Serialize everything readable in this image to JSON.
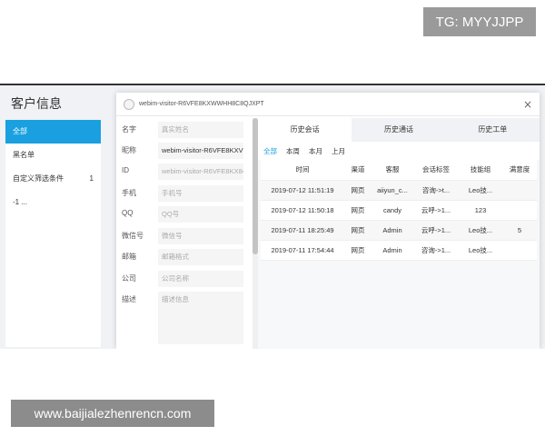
{
  "badge": "TG: MYYJJPP",
  "page_title": "客户信息",
  "sidebar": {
    "items": [
      {
        "label": "全部",
        "count": ""
      },
      {
        "label": "黑名单",
        "count": ""
      },
      {
        "label": "自定义筛选条件",
        "count": "1"
      },
      {
        "label": "-1 ...",
        "count": ""
      }
    ]
  },
  "modal": {
    "title": "webim-visitor-R6VFE8KXWWHH8C8QJXPT",
    "close": "×",
    "fields": [
      {
        "label": "名字",
        "value": "真实姓名",
        "filled": false
      },
      {
        "label": "昵称",
        "value": "webim-visitor-R6VFE8KXV",
        "filled": true
      },
      {
        "label": "ID",
        "value": "webim-visitor-R6VFE8KX8♦",
        "filled": false
      },
      {
        "label": "手机",
        "value": "手机号",
        "filled": false
      },
      {
        "label": "QQ",
        "value": "QQ号",
        "filled": false
      },
      {
        "label": "微信号",
        "value": "微信号",
        "filled": false
      },
      {
        "label": "邮箱",
        "value": "邮箱格式",
        "filled": false
      },
      {
        "label": "公司",
        "value": "公司名称",
        "filled": false
      },
      {
        "label": "描述",
        "value": "描述信息",
        "filled": false
      }
    ]
  },
  "tabs": [
    "历史会话",
    "历史通话",
    "历史工单"
  ],
  "filters": [
    "全部",
    "本周",
    "本月",
    "上月"
  ],
  "table": {
    "headers": [
      "时间",
      "渠道",
      "客服",
      "会话标签",
      "技能组",
      "满意度"
    ],
    "rows": [
      [
        "2019-07-12 11:51:19",
        "网页",
        "aiiyun_c...",
        "咨询->t...",
        "Leo技...",
        ""
      ],
      [
        "2019-07-12 11:50:18",
        "网页",
        "candy",
        "云呼->1...",
        "123",
        ""
      ],
      [
        "2019-07-11 18:25:49",
        "网页",
        "Admin",
        "云呼->1...",
        "Leo技...",
        "5"
      ],
      [
        "2019-07-11 17:54:44",
        "网页",
        "Admin",
        "咨询->1...",
        "Leo技...",
        ""
      ]
    ]
  },
  "watermark": "www.baijialezhenrencn.com"
}
